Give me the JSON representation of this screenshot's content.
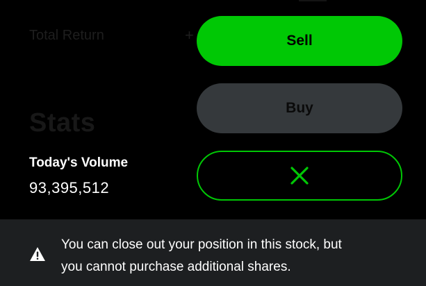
{
  "background": {
    "total_return_label": "Total Return",
    "plus_sign": "+",
    "stats_heading": "Stats"
  },
  "stats": {
    "volume_label": "Today's Volume",
    "volume_value": "93,395,512"
  },
  "actions": {
    "sell_label": "Sell",
    "buy_label": "Buy",
    "close_icon": "close-icon",
    "buy_enabled": false
  },
  "notice": {
    "icon": "warning-icon",
    "text_line1": "You can close out your position in this stock, but",
    "text_line2": "you cannot purchase additional shares."
  },
  "colors": {
    "accent": "#00c805",
    "background": "#000000",
    "disabled_button": "#35393c",
    "notice_background": "#1d1f21",
    "text": "#ffffff"
  }
}
